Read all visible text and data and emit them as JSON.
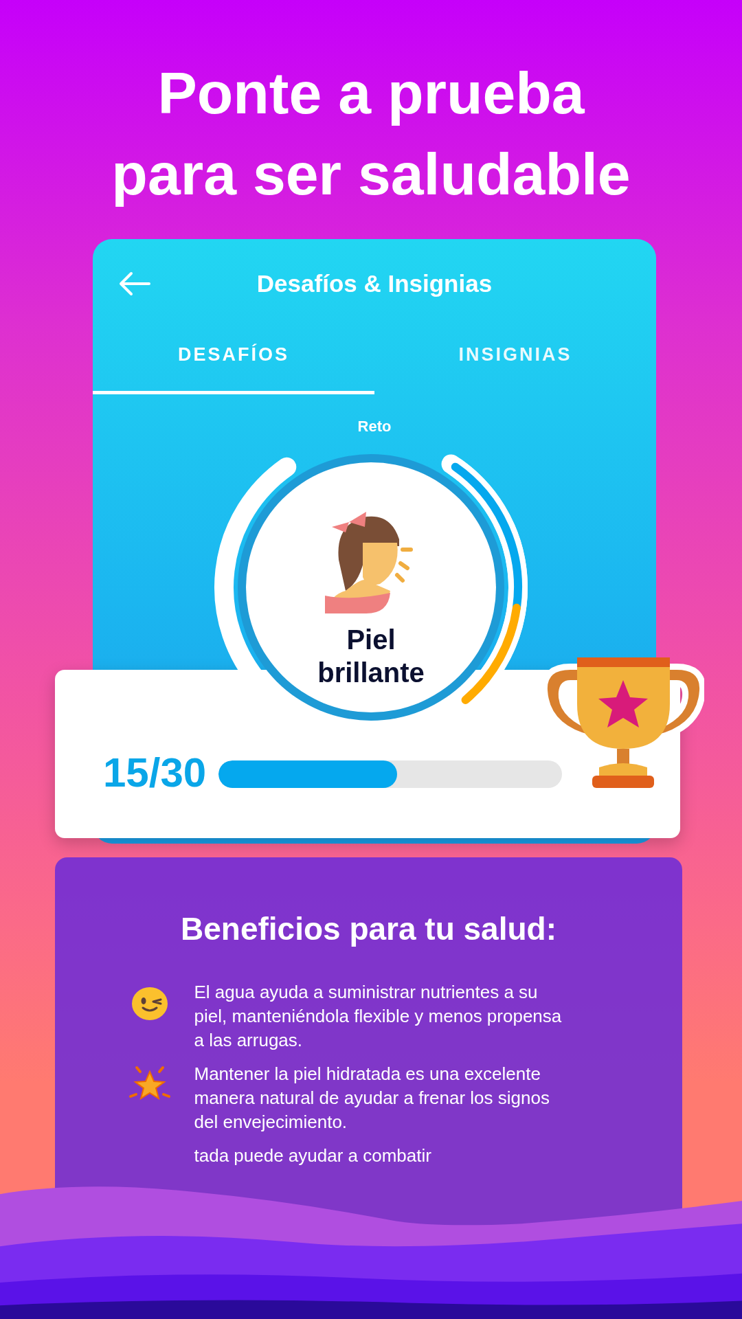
{
  "headline": [
    "Ponte a prueba",
    "para ser saludable"
  ],
  "window": {
    "title": "Desafíos & Insignias"
  },
  "tabs": [
    {
      "label": "DESAFÍOS",
      "selected": true
    },
    {
      "label": "INSIGNIAS",
      "selected": false
    }
  ],
  "challenge": {
    "caption": "Reto",
    "name": "Piel brillante",
    "count": "15/30",
    "level": 0.52
  },
  "benefits": {
    "title": "Beneficios para tu salud:",
    "items": [
      {
        "kind": "wink",
        "text": "El agua ayuda a suministrar nutrientes a su piel, manteniéndola flexible y menos propensa a las arrugas."
      },
      {
        "kind": "star",
        "text": "Mantener la piel hidratada es una excelente manera natural de ayudar a frenar los signos del envejecimiento."
      },
      {
        "kind": "none",
        "text": "tada puede ayudar a combatir"
      }
    ]
  }
}
